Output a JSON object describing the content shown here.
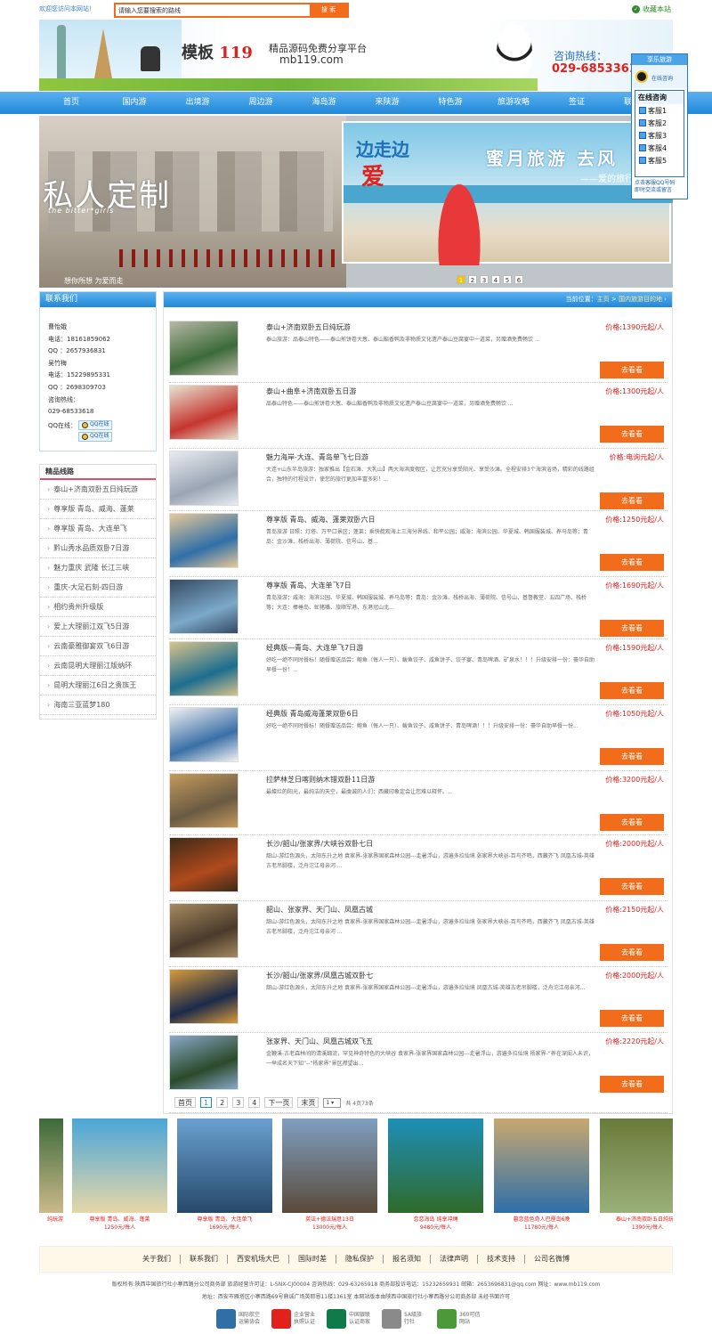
{
  "topbar": {
    "welcome": "欢迎您访问本网站！",
    "search_placeholder": "请输入您要搜索的路线",
    "search_button": "搜 索",
    "favorite": "收藏本站"
  },
  "banner": {
    "logo_text": "模板",
    "logo_num": "119",
    "slogan": "精品源码免费分享平台",
    "site": "mb119.com",
    "hotline_label": "咨询热线：",
    "hotline": "029-6853361"
  },
  "nav": {
    "items": [
      "首页",
      "国内游",
      "出境游",
      "周边游",
      "海岛游",
      "来陕游",
      "特色游",
      "旅游攻略",
      "签证",
      "联系我们"
    ]
  },
  "qq_float": {
    "head": "享乐旅游",
    "top_label": "在线咨询",
    "online_title": "在线咨询",
    "agents": [
      "客服1",
      "客服2",
      "客服3",
      "客服4",
      "客服5"
    ],
    "bottom1": "点击客服QQ号码",
    "bottom2": "即时交流或留言"
  },
  "slider": {
    "left_title": "私人定制",
    "left_sub": "the bitter*girls",
    "left_caption": "想你所想 为爱而走",
    "right_title1": "边走边",
    "right_title2": "爱",
    "right_slogan": "蜜月旅游 去风",
    "right_sub": "——爱的旅行",
    "pages": [
      "1",
      "2",
      "3",
      "4",
      "5",
      "6"
    ],
    "active_page": "1"
  },
  "contact": {
    "title": "联系我们",
    "lines": [
      "曹怡娥",
      "电话：18161859062",
      "QQ ：2657936831",
      "吴竹梅",
      "电话：15229895331",
      "QQ ：2698309703",
      "咨询热线：",
      "029-68533618"
    ],
    "qq_label": "QQ在线：",
    "qq_buttons": [
      "QQ在线",
      "QQ在线"
    ]
  },
  "routes": {
    "title": "精品线路",
    "items": [
      "泰山+济南双卧五日纯玩游",
      "尊享版 青岛、威海、蓬莱",
      "尊享版 青岛、大连单飞",
      "黔山秀水品质双卧7日游",
      "魅力重庆 武隆 长江三峡",
      "重庆-大足石刻-四日游",
      "相约贵州升级版",
      "爱上大理丽江双飞5日游",
      "云南豪雅御宴双飞6日游",
      "云南昆明大理丽江版纳环",
      "昆明大理丽江6日之贵族王",
      "海南三亚蓝梦180"
    ]
  },
  "crumb": {
    "prefix": "当前位置：",
    "home": "主页",
    "sep": " > ",
    "current": "国内旅游目的地"
  },
  "products": [
    {
      "title": "泰山+济南双卧五日纯玩游",
      "desc": "泰山旅游：品泰山特色——泰山煎饼卷大葱、泰山豁香鸭及非物质文化遗产泰山豆腐宴中一道菜，另赠酒免费畅饮 ...",
      "price": "价格:1390元起/人",
      "btn": "去看看"
    },
    {
      "title": "泰山+曲阜+济南双卧五日游",
      "desc": "品泰山特色——泰山煎饼卷大葱、泰山豁香鸭及非物质文化遗产泰山豆腐宴中一道菜，另赠酒免费畅饮 ...",
      "price": "价格:1300元起/人",
      "btn": "去看看"
    },
    {
      "title": "魅力海岸-大连、青岛单飞七日游",
      "desc": "大连+山东半岛旅游：独家推出【金石滩、大乳山】两大海滨度假区，让您充分享受阳光、享受沙滩。全程安排3个海滨浴场，精彩的线路组合，独特的行程设计，使您的旅行更加丰富多彩！...",
      "price": "价格:电询元起/人",
      "btn": "去看看"
    },
    {
      "title": "尊享版 青岛、威海、蓬莱双卧六日",
      "desc": "青岛旅游 日照：灯塔、万平口景区；蓬莱：乘快艇观海上三海分界线、和平公园；威海：海滨公园、华夏城、韩国服装城、养马岛等；青岛：金沙滩、栈桥出海、薄荷院、信号山、基...",
      "price": "价格:1250元起/人",
      "btn": "去看看"
    },
    {
      "title": "尊享版 青岛、大连单飞7日",
      "desc": "青岛旅游；威海：海滨公园、华夏城、韩国服装城、养马岛等；青岛：金沙滩、栈桥出海、薄荷院、信号山、基督教堂、五四广场、栈桥等；大连：棒棰岛、虻猪嘴、旅顺军港、东港冠山北...",
      "price": "价格:1690元起/人",
      "btn": "去看看"
    },
    {
      "title": "经典版—青岛、大连单飞7日游",
      "desc": "好吃一绝不同时餐标！随餐赠送品尝：鲍鱼（每人一只）、鲅鱼饺子、咸鱼饼子、饺子宴、青岛啤酒、矿泉水！！！升级安排一份：豪华自助早餐一份！...",
      "price": "价格:1590元起/人",
      "btn": "去看看"
    },
    {
      "title": "经典版 青岛威海蓬莱双卧6日",
      "desc": "好吃一绝不同时餐标！随餐赠送品尝：鲍鱼（每人一只）、鲅鱼饺子、咸鱼饼子、青岛啤酒！！！升级安排一份：豪华自助早餐一份...",
      "price": "价格:1050元起/人",
      "btn": "去看看"
    },
    {
      "title": "拉萨林芝日喀则纳木错双卧11日游",
      "desc": "最燦烂的阳光，最纯洁的天空，最虔诚的人们：西藏印象定会让您难以释怀。...",
      "price": "价格:3200元起/人",
      "btn": "去看看"
    },
    {
      "title": "长沙/韶山/张家界/大峡谷双卧七日",
      "desc": "韶山-游红色源头，太阳东升之地 袁家界-张家界国家森林公园---走暑浮山，游遍多拉仙境 张家界大峡谷-百鸟齐鸣，西藏齐飞 凤凰古城-英雄古老吊脚楼，泛舟沱江母亲河 ...",
      "price": "价格:2000元起/人",
      "btn": "去看看"
    },
    {
      "title": "韶山、张家界、天门山、凤凰古城",
      "desc": "韶山-游红色源头，太阳东升之地 袁家界-张家界国家森林公园---走暑浮山，游遍多拉仙境 张家界大峡谷-百鸟齐鸣，西藏齐飞 凤凰古城-英雄古老吊脚楼，泛舟沱江母亲河 ...",
      "price": "价格:2150元起/人",
      "btn": "去看看"
    },
    {
      "title": "长沙/韶山/张家界/凤凰古城双卧七",
      "desc": "韶山-游红色源头，太阳东升之地 袁家界-张家界国家森林公园---走暑浮山，游遍多拉仙境 凤凰古城-英雄古老吊脚楼，泛舟沱江母亲河...",
      "price": "价格:2000元起/人",
      "btn": "去看看"
    },
    {
      "title": "张家界、天门山、凤凰古城双飞五",
      "desc": "金鞭溪-古老森林间的清溪细流，罕见神奇特色的大峡谷 袁家界-张家界国家森林公园---走暑浮山，游遍多拉仙境 杨家界-“养在深闺人未识，一举成名天下知”--“杨家界”景区襟望出...",
      "price": "价格:2220元起/人",
      "btn": "去看看"
    }
  ],
  "pager": {
    "first": "首页",
    "pages": [
      "1",
      "2",
      "3",
      "4"
    ],
    "active": "1",
    "next": "下一页",
    "last": "末页",
    "select": "1",
    "total": "共 4页73条"
  },
  "gallery": [
    {
      "name": "纯玩游",
      "price": ""
    },
    {
      "name": "尊享版 青岛、威海、蓬莱",
      "price": "1250元/每人"
    },
    {
      "name": "尊享版 青岛、大连单飞",
      "price": "1690元/每人"
    },
    {
      "name": "英法+德法瑞意13日",
      "price": "13000元/每人"
    },
    {
      "name": "恋恋海岛 纯享冲绳",
      "price": "9480元/每人"
    },
    {
      "name": "暮恋蓝色奇人巴厘岛6晚",
      "price": "11780元/每人"
    },
    {
      "name": "泰山+济南双卧五日纯玩游",
      "price": "1390元/每人"
    }
  ],
  "footer": {
    "links": [
      "关于我们",
      "联系我们",
      "西安机场大巴",
      "国际时差",
      "隐私保护",
      "报名须知",
      "法律声明",
      "技术支持",
      "公司名微博"
    ],
    "copy1": "版权所有:陕西中国旅行社小寨西路分公司商务部 旅游经营许可证：L-SNX-CJ00004 咨询热线：029-63265918 商务部投诉电话：15232659931 邮箱：2653696831@qq.com 网址：www.mb119.com",
    "copy2": "地址：西安市雁塔区小寨西路69号鼎诚广场英耶恩11楼1361室 本网站版本由陕西中国旅行社小寨西路分公司商务部 未经书面许可",
    "badges": [
      {
        "l1": "国际航空",
        "l2": "运输协会",
        "icon": "iata-icon"
      },
      {
        "l1": "企业营业",
        "l2": "执照认证",
        "icon": "license-icon"
      },
      {
        "l1": "中国银联",
        "l2": "认证商家",
        "icon": "unionpay-icon"
      },
      {
        "l1": "5A级旅",
        "l2": "行社",
        "icon": "5a-icon"
      },
      {
        "l1": "360可信",
        "l2": "网站",
        "icon": "360-icon"
      }
    ]
  },
  "colors": {
    "accent": "#2088d8",
    "orange": "#f26d1b",
    "price": "#e2211c"
  }
}
